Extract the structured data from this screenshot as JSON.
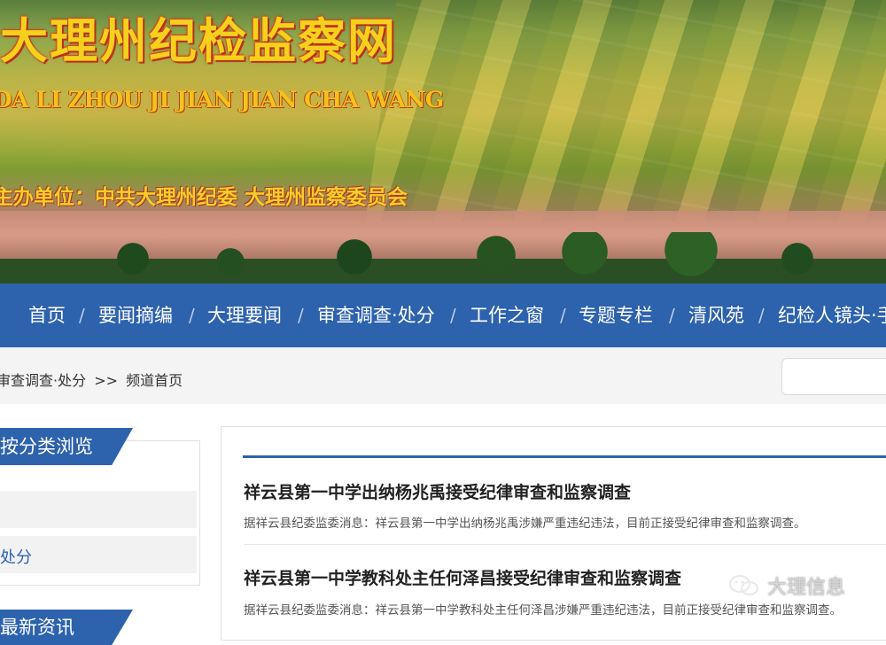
{
  "header": {
    "title": "大理州纪检监察网",
    "pinyin": "DA LI ZHOU JI JIAN JIAN CHA WANG",
    "sponsor": "主办单位：中共大理州纪委  大理州监察委员会"
  },
  "nav": {
    "items": [
      "首页",
      "要闻摘编",
      "大理要闻",
      "审查调查·处分",
      "工作之窗",
      "专题专栏",
      "清风苑",
      "纪检人镜头·手"
    ]
  },
  "breadcrumb": {
    "parent": "审查调查·处分",
    "separator": ">>",
    "current": "频道首页"
  },
  "search": {
    "placeholder": ""
  },
  "sidebar": {
    "section1_title": "按分类浏览",
    "items": [
      {
        "label": ""
      },
      {
        "label": "处分"
      }
    ],
    "section2_title": "最新资讯"
  },
  "articles": [
    {
      "title": "祥云县第一中学出纳杨兆禹接受纪律审查和监察调查",
      "summary": "据祥云县纪委监委消息：祥云县第一中学出纳杨兆禹涉嫌严重违纪违法，目前正接受纪律审查和监察调查。"
    },
    {
      "title": "祥云县第一中学教科处主任何泽昌接受纪律审查和监察调查",
      "summary": "据祥云县纪委监委消息：祥云县第一中学教科处主任何泽昌涉嫌严重违纪违法，目前正接受纪律审查和监察调查。"
    }
  ],
  "watermark": {
    "text": "大理信息",
    "icon": "wechat-icon"
  },
  "colors": {
    "nav_bg": "#2d62ad",
    "accent": "#2d62ad"
  }
}
